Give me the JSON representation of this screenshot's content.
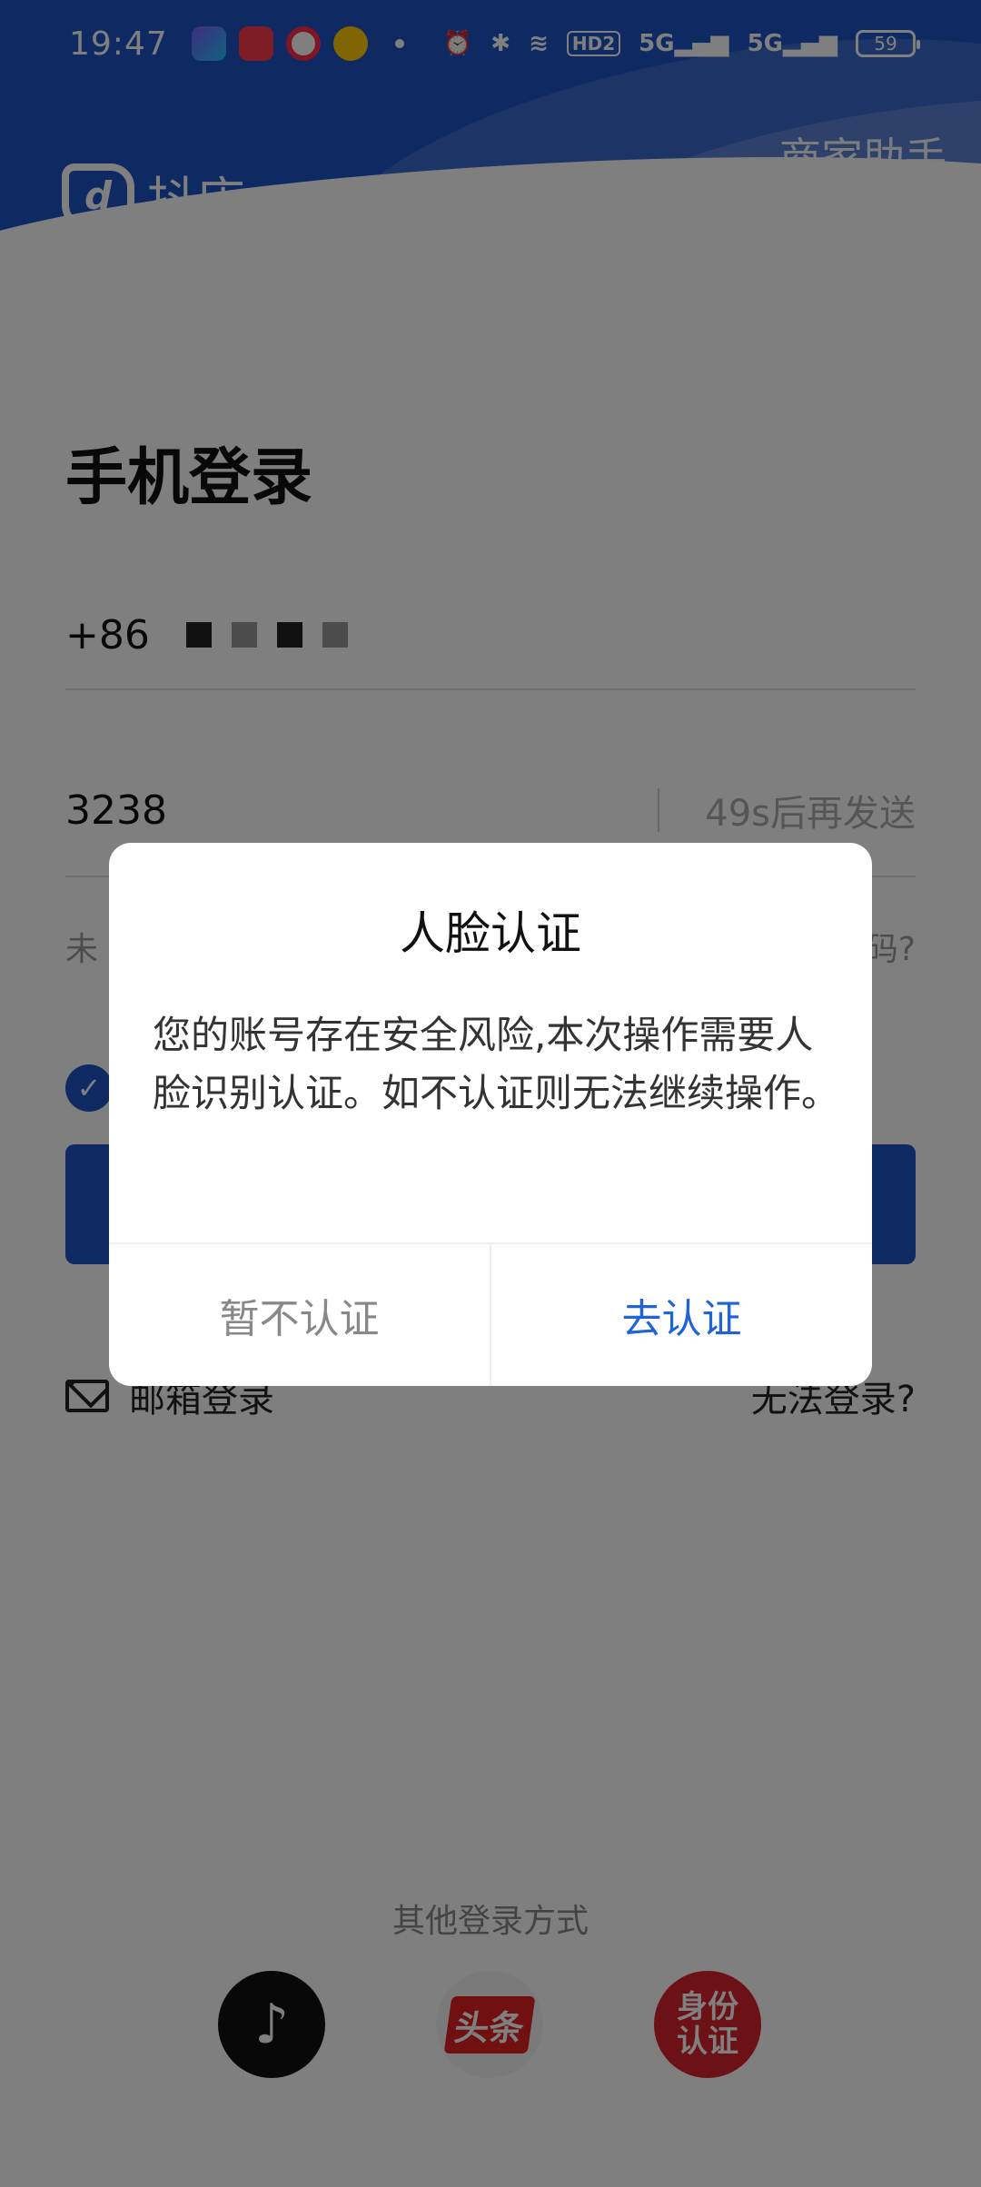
{
  "status_bar": {
    "time": "19:47",
    "battery": "59",
    "network_labels": [
      "5G",
      "5G"
    ],
    "hd_badge": "HD2"
  },
  "header": {
    "logo_text": "抖店",
    "logo_mark": "d",
    "assistant_label": "商家助手",
    "brand_color": "#1e54c6"
  },
  "form": {
    "title": "手机登录",
    "country_code": "+86",
    "verification_code": "3238",
    "resend_label": "49s后再发送",
    "hint_left": "未",
    "hint_right": "码?",
    "email_login_label": "邮箱登录",
    "cant_login_label": "无法登录?"
  },
  "other_login": {
    "label": "其他登录方式",
    "methods": [
      {
        "icon": "douyin-icon"
      },
      {
        "icon": "toutiao-icon",
        "text": "头条"
      },
      {
        "icon": "id-card-icon",
        "text": "身份\n认证"
      }
    ]
  },
  "dialog": {
    "title": "人脸认证",
    "body": "您的账号存在安全风险,本次操作需要人脸识别认证。如不认证则无法继续操作。",
    "cancel_label": "暂不认证",
    "confirm_label": "去认证",
    "confirm_color": "#1e64d8"
  }
}
